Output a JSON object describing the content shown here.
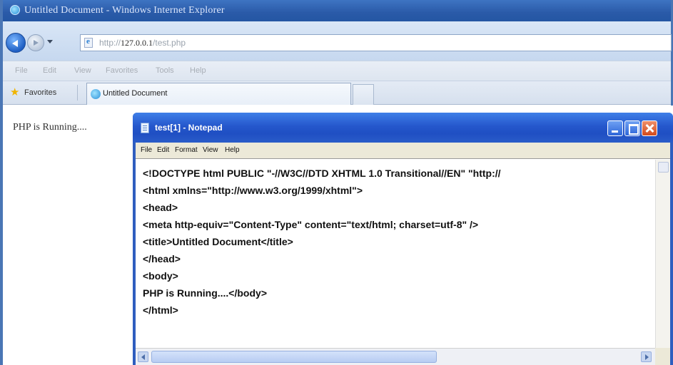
{
  "browser": {
    "title": "Untitled Document - Windows Internet Explorer",
    "address": {
      "prefix": "http://",
      "host": "127.0.0.1",
      "path": "/test.php"
    },
    "menu": [
      "File",
      "Edit",
      "View",
      "Favorites",
      "Tools",
      "Help"
    ],
    "favorites_label": "Favorites",
    "tab_label": "Untitled Document",
    "page_text": "PHP is Running...."
  },
  "notepad": {
    "title": "test[1] - Notepad",
    "menu": [
      "File",
      "Edit",
      "Format",
      "View",
      "Help"
    ],
    "lines": [
      "<!DOCTYPE html PUBLIC \"-//W3C//DTD XHTML 1.0 Transitional//EN\" \"http://",
      "<html xmlns=\"http://www.w3.org/1999/xhtml\">",
      "<head>",
      "<meta http-equiv=\"Content-Type\" content=\"text/html; charset=utf-8\" />",
      "<title>Untitled Document</title>",
      "</head>",
      "<body>",
      "PHP is Running....</body>",
      "</html>"
    ]
  },
  "colors": {
    "titlebar_blue": "#2557cc",
    "close_red": "#d24a1c",
    "xp_menu_bg": "#ece9d8"
  },
  "icons": [
    "ie-logo-icon",
    "back-arrow-icon",
    "forward-arrow-icon",
    "page-icon",
    "star-icon",
    "notepad-icon",
    "minimize-icon",
    "maximize-icon",
    "close-icon"
  ]
}
